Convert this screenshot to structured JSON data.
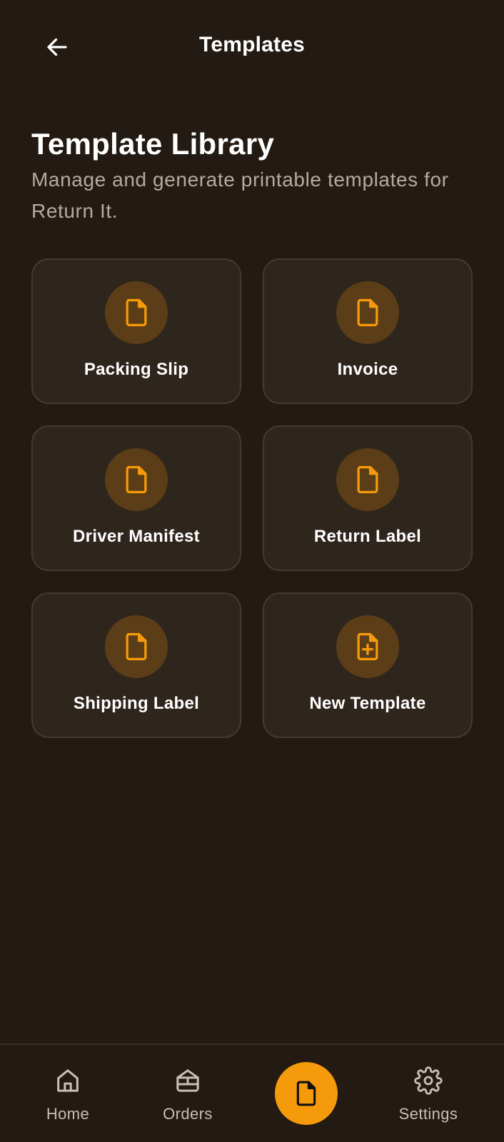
{
  "header": {
    "title": "Templates",
    "back_icon": "arrow-left-icon"
  },
  "page": {
    "title": "Template Library",
    "subtitle": "Manage and generate printable templates for Return It."
  },
  "templates": [
    {
      "label": "Packing Slip",
      "icon": "document-icon"
    },
    {
      "label": "Invoice",
      "icon": "document-icon"
    },
    {
      "label": "Driver Manifest",
      "icon": "document-icon"
    },
    {
      "label": "Return Label",
      "icon": "document-icon"
    },
    {
      "label": "Shipping Label",
      "icon": "document-icon"
    },
    {
      "label": "New Template",
      "icon": "document-plus-icon"
    }
  ],
  "bottom_nav": {
    "items": [
      {
        "label": "Home",
        "icon": "home-icon"
      },
      {
        "label": "Orders",
        "icon": "box-icon"
      },
      {
        "label": "",
        "icon": "document-icon",
        "active": true
      },
      {
        "label": "Settings",
        "icon": "gear-icon"
      }
    ]
  },
  "colors": {
    "background": "#231b13",
    "card": "#2e251d",
    "card_border": "#46392d",
    "accent": "#f59a0a",
    "icon_circle": "#5b3d17",
    "muted_text": "#b6aa9d"
  }
}
